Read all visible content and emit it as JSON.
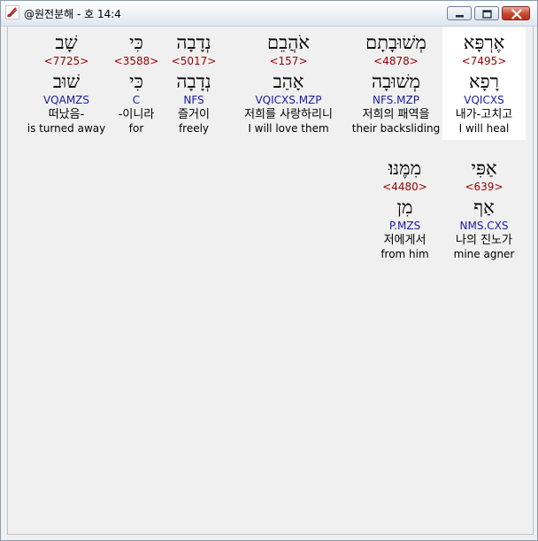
{
  "window": {
    "title": "@원전분해 - 호 14:4"
  },
  "verse_words": [
    {
      "hebrew": "אֶרְפָּא",
      "strong": "<7495>",
      "lemma": "רָפָא",
      "morph": "VQICXS",
      "korean": "내가-고치고",
      "english": "I will heal",
      "selected": true
    },
    {
      "hebrew": "מְשׁוּבָתָם",
      "strong": "<4878>",
      "lemma": "מְשׁוּבָה",
      "morph": "NFS.MZP",
      "korean": "저희의 패역을",
      "english": "their backsliding",
      "selected": false
    },
    {
      "hebrew": "אֹהֲבֵם",
      "strong": "<157>",
      "lemma": "אָהַב",
      "morph": "VQICXS.MZP",
      "korean": "저희를 사랑하리니",
      "english": "I will love them",
      "selected": false
    },
    {
      "hebrew": "נְדָבָה",
      "strong": "<5017>",
      "lemma": "נְדָבָה",
      "morph": "NFS",
      "korean": "즐거이",
      "english": "freely",
      "selected": false
    },
    {
      "hebrew": "כִּי",
      "strong": "<3588>",
      "lemma": "כִּי",
      "morph": "C",
      "korean": "-이니라",
      "english": "for",
      "selected": false
    },
    {
      "hebrew": "שָׁב",
      "strong": "<7725>",
      "lemma": "שׁוּב",
      "morph": "VQAMZS",
      "korean": "떠났음-",
      "english": "is turned away",
      "selected": false
    },
    {
      "hebrew": "אַפִּי",
      "strong": "<639>",
      "lemma": "אַף",
      "morph": "NMS.CXS",
      "korean": "나의 진노가",
      "english": "mine agner",
      "selected": false
    },
    {
      "hebrew": "מִמֶּנּוּ׃",
      "strong": "<4480>",
      "lemma": "מִן",
      "morph": "P.MZS",
      "korean": "저에게서",
      "english": "from him",
      "selected": false
    }
  ]
}
